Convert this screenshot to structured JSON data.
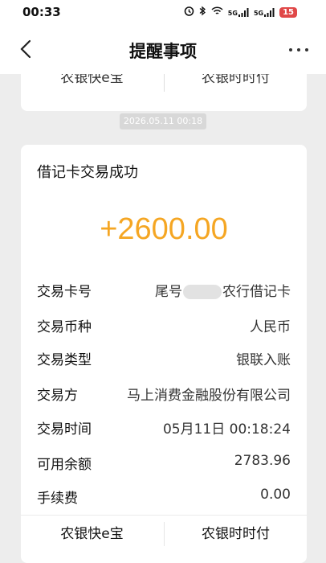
{
  "status_bar": {
    "time": "00:33",
    "icons": [
      "alarm-icon",
      "bluetooth-icon",
      "wifi-icon",
      "signal-5g-icon",
      "signal-5g-icon"
    ],
    "signal_label_1": "5G",
    "signal_label_2": "5G",
    "battery": "15"
  },
  "nav": {
    "title": "提醒事项"
  },
  "previous_card": {
    "left_button": "农银快e宝",
    "right_button": "农银时时付"
  },
  "message": {
    "timestamp": "2026.05.11 00:18",
    "title": "借记卡交易成功",
    "amount": "+2600.00",
    "amount_color": "#f5a623",
    "details": [
      {
        "label": "交易卡号",
        "value_prefix": "尾号",
        "value_suffix": "农行借记卡"
      },
      {
        "label": "交易币种",
        "value": "人民币"
      },
      {
        "label": "交易类型",
        "value": "银联入账"
      },
      {
        "label": "交易方",
        "value": "马上消费金融股份有限公司"
      },
      {
        "label": "交易时间",
        "value": "05月11日 00:18:24"
      },
      {
        "label": "可用余额",
        "value": "2783.96"
      },
      {
        "label": "手续费",
        "value": "0.00"
      }
    ],
    "actions": {
      "left": "农银快e宝",
      "right": "农银时时付"
    }
  }
}
